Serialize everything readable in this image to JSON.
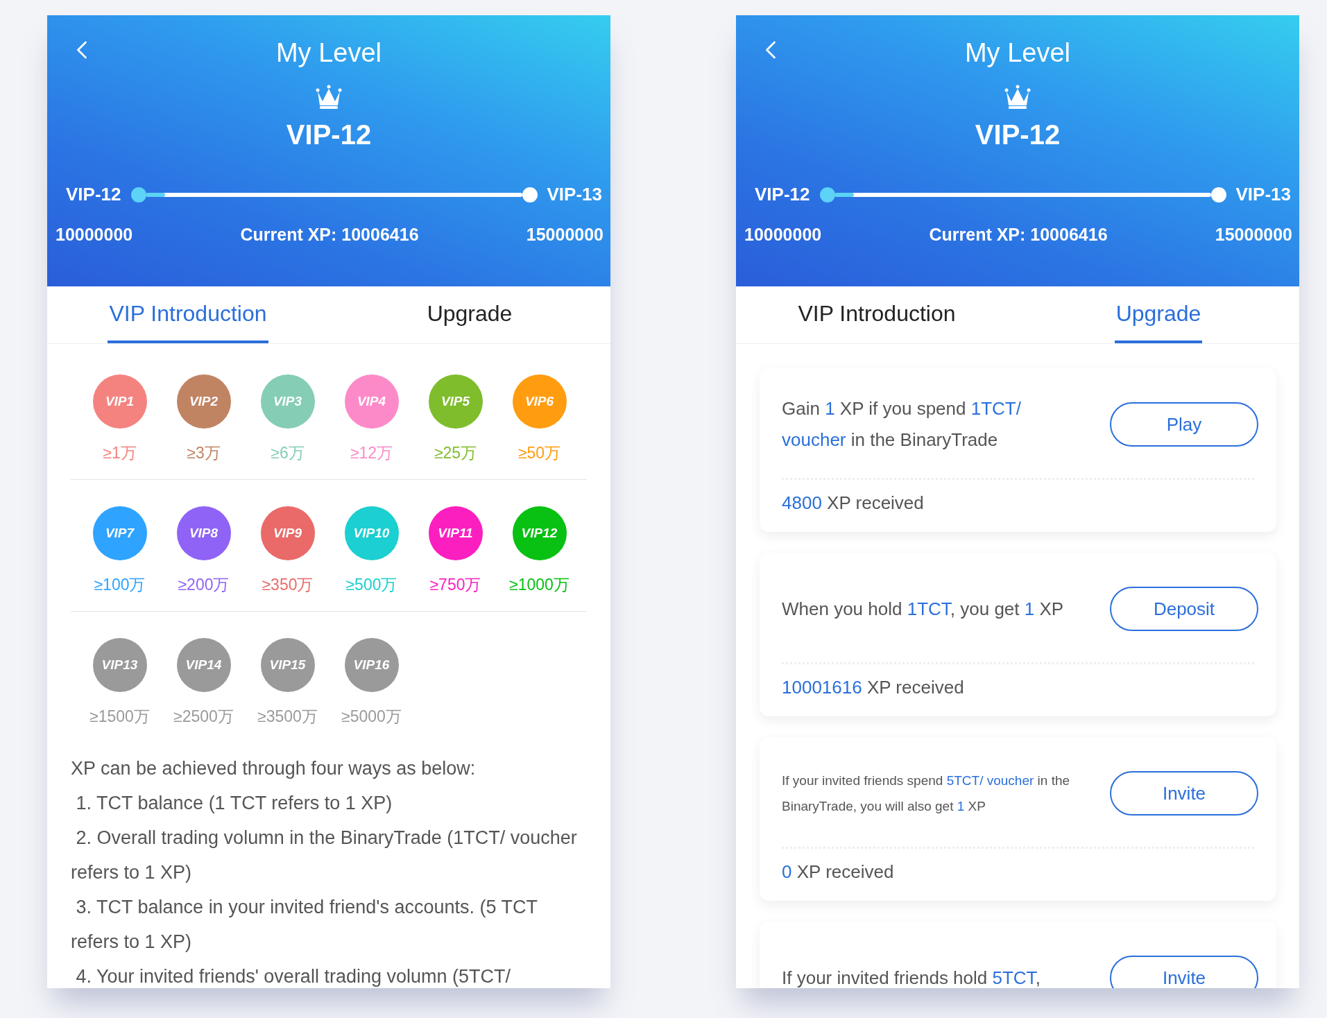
{
  "screens": [
    {
      "header": {
        "title": "My Level",
        "level_name": "VIP-12",
        "current_level": "VIP-12",
        "next_level": "VIP-13",
        "min_xp": "10000000",
        "current_xp": "Current XP: 10006416",
        "max_xp": "15000000",
        "level": 0.05
      },
      "tabs": [
        {
          "label": "VIP Introduction",
          "selected": true
        },
        {
          "label": "Upgrade",
          "selected": false
        }
      ],
      "content": {
        "kind": "introduction",
        "badge_rows": [
          [
            {
              "label": "VIP1",
              "threshold": "≥1万",
              "color": "#f4837f"
            },
            {
              "label": "VIP2",
              "threshold": "≥3万",
              "color": "#c08463"
            },
            {
              "label": "VIP3",
              "threshold": "≥6万",
              "color": "#86cdb6"
            },
            {
              "label": "VIP4",
              "threshold": "≥12万",
              "color": "#fd8ac8"
            },
            {
              "label": "VIP5",
              "threshold": "≥25万",
              "color": "#7fbd2d"
            },
            {
              "label": "VIP6",
              "threshold": "≥50万",
              "color": "#ff9c10"
            }
          ],
          [
            {
              "label": "VIP7",
              "threshold": "≥100万",
              "color": "#2ea3ff"
            },
            {
              "label": "VIP8",
              "threshold": "≥200万",
              "color": "#8f63f5"
            },
            {
              "label": "VIP9",
              "threshold": "≥350万",
              "color": "#e96a68"
            },
            {
              "label": "VIP10",
              "threshold": "≥500万",
              "color": "#1ccfd0"
            },
            {
              "label": "VIP11",
              "threshold": "≥750万",
              "color": "#fb1fc0"
            },
            {
              "label": "VIP12",
              "threshold": "≥1000万",
              "color": "#08c113"
            }
          ],
          [
            {
              "label": "VIP13",
              "threshold": "≥1500万",
              "color": "#9a9a9a"
            },
            {
              "label": "VIP14",
              "threshold": "≥2500万",
              "color": "#9a9a9a"
            },
            {
              "label": "VIP15",
              "threshold": "≥3500万",
              "color": "#9a9a9a"
            },
            {
              "label": "VIP16",
              "threshold": "≥5000万",
              "color": "#9a9a9a"
            }
          ]
        ],
        "paragraphs": [
          "XP can be achieved through four ways as below:",
          " 1. TCT balance (1 TCT refers to 1 XP)",
          " 2. Overall trading volumn in the BinaryTrade (1TCT/ voucher refers to 1 XP)",
          " 3. TCT balance in your invited friend's accounts. (5 TCT refers to 1 XP)",
          " 4. Your invited friends' overall trading volumn (5TCT/"
        ]
      }
    },
    {
      "header": {
        "title": "My Level",
        "level_name": "VIP-12",
        "current_level": "VIP-12",
        "next_level": "VIP-13",
        "min_xp": "10000000",
        "current_xp": "Current XP: 10006416",
        "max_xp": "15000000",
        "level": 0.05
      },
      "tabs": [
        {
          "label": "VIP Introduction",
          "selected": false
        },
        {
          "label": "Upgrade",
          "selected": true
        }
      ],
      "content": {
        "kind": "upgrade",
        "cards": [
          {
            "compact": false,
            "text": [
              {
                "t": "Gain ",
                "highlight": false
              },
              {
                "t": "1",
                "highlight": true
              },
              {
                "t": " XP if you spend ",
                "highlight": false
              },
              {
                "t": "1TCT/ voucher",
                "highlight": true
              },
              {
                "t": " in the BinaryTrade",
                "highlight": false
              }
            ],
            "button": "Play",
            "received": {
              "value": "4800",
              "suffix": "XP received"
            }
          },
          {
            "compact": false,
            "text": [
              {
                "t": "When you hold ",
                "highlight": false
              },
              {
                "t": "1TCT",
                "highlight": true
              },
              {
                "t": ",  you get ",
                "highlight": false
              },
              {
                "t": "1",
                "highlight": true
              },
              {
                "t": " XP",
                "highlight": false
              }
            ],
            "button": "Deposit",
            "received": {
              "value": "10001616",
              "suffix": "XP received"
            }
          },
          {
            "compact": true,
            "text": [
              {
                "t": "If your invited friends spend ",
                "highlight": false
              },
              {
                "t": "5TCT/ voucher",
                "highlight": true
              },
              {
                "t": " in the BinaryTrade, you will also get ",
                "highlight": false
              },
              {
                "t": "1",
                "highlight": true
              },
              {
                "t": " XP",
                "highlight": false
              }
            ],
            "button": "Invite",
            "received": {
              "value": "0",
              "suffix": "XP received"
            }
          },
          {
            "compact": false,
            "text": [
              {
                "t": "If your invited friends hold ",
                "highlight": false
              },
              {
                "t": "5TCT",
                "highlight": true
              },
              {
                "t": ",",
                "highlight": false
              }
            ],
            "button": "Invite"
          }
        ]
      }
    }
  ]
}
